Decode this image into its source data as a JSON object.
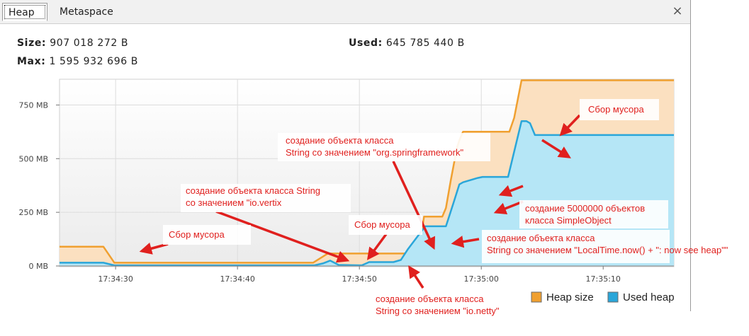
{
  "tabs": {
    "heap": "Heap",
    "metaspace": "Metaspace",
    "close": "×"
  },
  "stats": {
    "size_label": "Size:",
    "size_value": "907 018 272 B",
    "used_label": "Used:",
    "used_value": "645 785 440 B",
    "max_label": "Max:",
    "max_value": "1 595 932 696 B"
  },
  "colors": {
    "heap_line": "#f0a030",
    "heap_fill": "#fbe0c0",
    "used_line": "#2aa6d9",
    "used_fill": "#b5e6f6",
    "annotation": "#e0201e",
    "plot_bg": "#f4f4f4",
    "grid": "#dcdcdc"
  },
  "chart_data": {
    "type": "area",
    "x_unit": "time",
    "x_ticks": [
      "17:34:30",
      "17:34:40",
      "17:34:50",
      "17:35:00",
      "17:35:10"
    ],
    "y_ticks": [
      "0 MB",
      "250 MB",
      "500 MB",
      "750 MB"
    ],
    "ylim": [
      0,
      870
    ],
    "xlim": [
      "17:34:25.4",
      "17:35:15.8"
    ],
    "legend": {
      "placement": "bottom-right",
      "entries": [
        "Heap size",
        "Used heap"
      ]
    },
    "grid": true,
    "series": [
      {
        "name": "Heap size",
        "color": "#f0a030",
        "x": [
          "17:34:25.4",
          "17:34:29.0",
          "17:34:29.9",
          "17:34:46.2",
          "17:34:47.4",
          "17:34:53.7",
          "17:34:54.2",
          "17:34:55.0",
          "17:34:55.3",
          "17:34:56.8",
          "17:34:57.1",
          "17:34:57.5",
          "17:34:58.0",
          "17:34:58.2",
          "17:34:58.5",
          "17:34:59.1",
          "17:35:02.3",
          "17:35:02.7",
          "17:35:03.3",
          "17:35:15.8"
        ],
        "y": [
          90,
          90,
          15,
          15,
          58,
          58,
          70,
          110,
          230,
          230,
          270,
          400,
          550,
          585,
          625,
          625,
          625,
          690,
          865,
          865
        ]
      },
      {
        "name": "Used heap",
        "color": "#2aa6d9",
        "x": [
          "17:34:25.4",
          "17:34:29.0",
          "17:34:29.9",
          "17:34:46.3",
          "17:34:47.0",
          "17:34:47.6",
          "17:34:48.3",
          "17:34:50.2",
          "17:34:50.8",
          "17:34:52.8",
          "17:34:53.4",
          "17:34:54.0",
          "17:34:55.0",
          "17:34:55.4",
          "17:34:57.1",
          "17:34:57.7",
          "17:34:58.2",
          "17:34:58.5",
          "17:34:59.7",
          "17:35:00.1",
          "17:35:02.2",
          "17:35:03.3",
          "17:35:03.7",
          "17:35:04.0",
          "17:35:04.4",
          "17:35:15.8"
        ],
        "y": [
          15,
          15,
          3,
          3,
          12,
          25,
          5,
          3,
          18,
          18,
          28,
          80,
          155,
          185,
          185,
          290,
          380,
          390,
          410,
          415,
          415,
          675,
          675,
          665,
          610,
          610
        ]
      }
    ],
    "annotations": [
      {
        "id": "gc1",
        "lines": [
          "Сбор мусора"
        ]
      },
      {
        "id": "vertix",
        "lines": [
          "создание объекта класса  String",
          "со значением \"io.vertix"
        ]
      },
      {
        "id": "gc2",
        "lines": [
          "Сбор мусора"
        ]
      },
      {
        "id": "netty",
        "lines": [
          "создание объекта класса",
          "String со значением \"io.netty\""
        ]
      },
      {
        "id": "spring",
        "lines": [
          "создание объекта класса",
          "String со значением \"org.springframework\""
        ]
      },
      {
        "id": "simple",
        "lines": [
          "создание 5000000 объектов",
          "класса SimpleObject"
        ]
      },
      {
        "id": "localtime",
        "lines": [
          "создание объекта класса",
          "String со значением \"LocalTime.now() + \": now see heap\"\""
        ]
      },
      {
        "id": "gc3",
        "lines": [
          "Сбор мусора"
        ]
      }
    ]
  }
}
